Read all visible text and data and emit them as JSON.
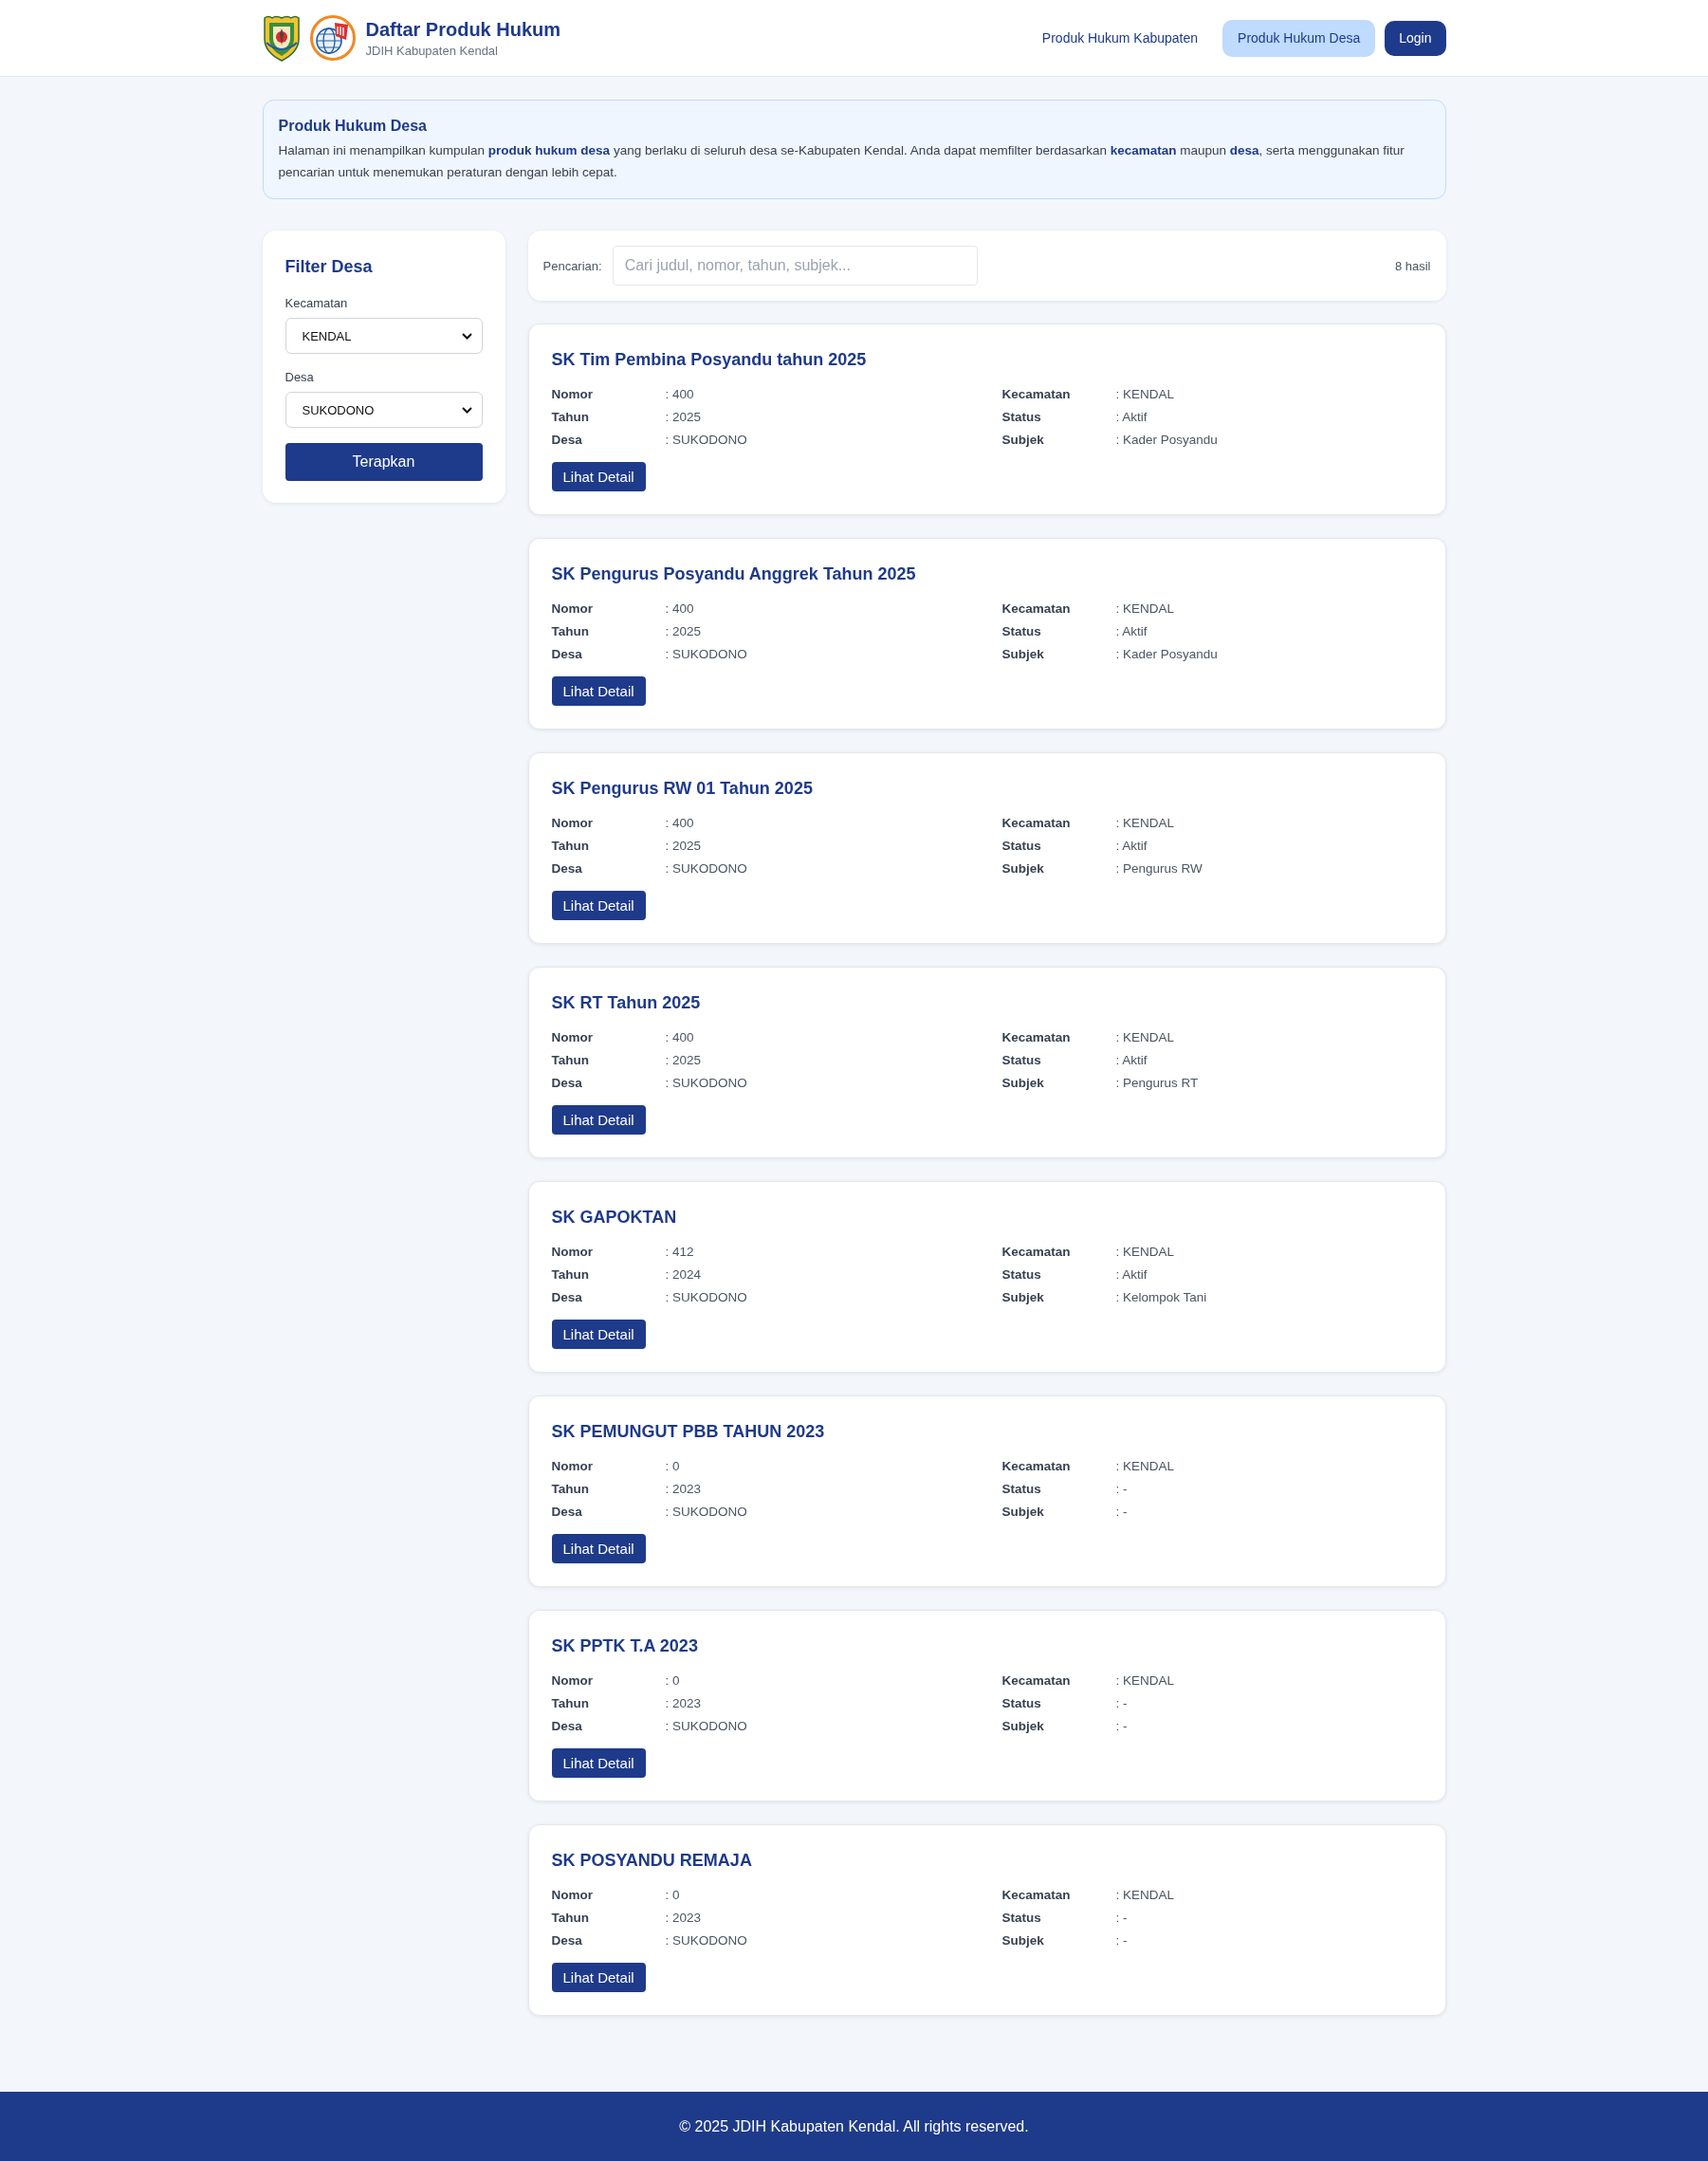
{
  "header": {
    "title": "Daftar Produk Hukum",
    "subtitle": "JDIH Kabupaten Kendal",
    "nav_links": [
      {
        "label": "Produk Hukum Kabupaten",
        "selected": false
      },
      {
        "label": "Produk Hukum Desa",
        "selected": true
      }
    ],
    "login_button": "Login"
  },
  "intro": {
    "title": "Produk Hukum Desa",
    "text": "Halaman ini menampilkan kumpulan **produk hukum desa** yang berlaku di seluruh desa se-Kabupaten Kendal. Anda dapat memfilter berdasarkan **kecamatan** maupun **desa**, serta menggunakan fitur pencarian untuk menemukan peraturan dengan lebih cepat."
  },
  "filter": {
    "title": "Filter Desa",
    "fields": [
      {
        "label": "Kecamatan",
        "value": "KENDAL"
      },
      {
        "label": "Desa",
        "value": "SUKODONO"
      }
    ],
    "button": "Terapkan"
  },
  "search": {
    "label": "Pencarian:",
    "placeholder": "Cari judul, nomor, tahun, subjek...",
    "count": "8 hasil"
  },
  "results": [
    {
      "title": "SK Tim Pembina Posyandu tahun 2025",
      "details": [
        [
          {
            "label": "Nomor",
            "value": ": 400"
          },
          {
            "label": "Tahun",
            "value": ": 2025"
          },
          {
            "label": "Desa",
            "value": ": SUKODONO"
          }
        ],
        [
          {
            "label": "Kecamatan",
            "value": ": KENDAL"
          },
          {
            "label": "Status",
            "value": ": Aktif"
          },
          {
            "label": "Subjek",
            "value": ": Kader Posyandu"
          }
        ]
      ],
      "button": "Lihat Detail"
    },
    {
      "title": "SK Pengurus Posyandu Anggrek Tahun 2025",
      "details": [
        [
          {
            "label": "Nomor",
            "value": ": 400"
          },
          {
            "label": "Tahun",
            "value": ": 2025"
          },
          {
            "label": "Desa",
            "value": ": SUKODONO"
          }
        ],
        [
          {
            "label": "Kecamatan",
            "value": ": KENDAL"
          },
          {
            "label": "Status",
            "value": ": Aktif"
          },
          {
            "label": "Subjek",
            "value": ": Kader Posyandu"
          }
        ]
      ],
      "button": "Lihat Detail"
    },
    {
      "title": "SK Pengurus RW 01 Tahun 2025",
      "details": [
        [
          {
            "label": "Nomor",
            "value": ": 400"
          },
          {
            "label": "Tahun",
            "value": ": 2025"
          },
          {
            "label": "Desa",
            "value": ": SUKODONO"
          }
        ],
        [
          {
            "label": "Kecamatan",
            "value": ": KENDAL"
          },
          {
            "label": "Status",
            "value": ": Aktif"
          },
          {
            "label": "Subjek",
            "value": ": Pengurus RW"
          }
        ]
      ],
      "button": "Lihat Detail"
    },
    {
      "title": "SK RT Tahun 2025",
      "details": [
        [
          {
            "label": "Nomor",
            "value": ": 400"
          },
          {
            "label": "Tahun",
            "value": ": 2025"
          },
          {
            "label": "Desa",
            "value": ": SUKODONO"
          }
        ],
        [
          {
            "label": "Kecamatan",
            "value": ": KENDAL"
          },
          {
            "label": "Status",
            "value": ": Aktif"
          },
          {
            "label": "Subjek",
            "value": ": Pengurus RT"
          }
        ]
      ],
      "button": "Lihat Detail"
    },
    {
      "title": "SK GAPOKTAN",
      "details": [
        [
          {
            "label": "Nomor",
            "value": ": 412"
          },
          {
            "label": "Tahun",
            "value": ": 2024"
          },
          {
            "label": "Desa",
            "value": ": SUKODONO"
          }
        ],
        [
          {
            "label": "Kecamatan",
            "value": ": KENDAL"
          },
          {
            "label": "Status",
            "value": ": Aktif"
          },
          {
            "label": "Subjek",
            "value": ": Kelompok Tani"
          }
        ]
      ],
      "button": "Lihat Detail"
    },
    {
      "title": "SK PEMUNGUT PBB TAHUN 2023",
      "details": [
        [
          {
            "label": "Nomor",
            "value": ": 0"
          },
          {
            "label": "Tahun",
            "value": ": 2023"
          },
          {
            "label": "Desa",
            "value": ": SUKODONO"
          }
        ],
        [
          {
            "label": "Kecamatan",
            "value": ": KENDAL"
          },
          {
            "label": "Status",
            "value": ": -"
          },
          {
            "label": "Subjek",
            "value": ": -"
          }
        ]
      ],
      "button": "Lihat Detail"
    },
    {
      "title": "SK PPTK T.A 2023",
      "details": [
        [
          {
            "label": "Nomor",
            "value": ": 0"
          },
          {
            "label": "Tahun",
            "value": ": 2023"
          },
          {
            "label": "Desa",
            "value": ": SUKODONO"
          }
        ],
        [
          {
            "label": "Kecamatan",
            "value": ": KENDAL"
          },
          {
            "label": "Status",
            "value": ": -"
          },
          {
            "label": "Subjek",
            "value": ": -"
          }
        ]
      ],
      "button": "Lihat Detail"
    },
    {
      "title": "SK POSYANDU REMAJA",
      "details": [
        [
          {
            "label": "Nomor",
            "value": ": 0"
          },
          {
            "label": "Tahun",
            "value": ": 2023"
          },
          {
            "label": "Desa",
            "value": ": SUKODONO"
          }
        ],
        [
          {
            "label": "Kecamatan",
            "value": ": KENDAL"
          },
          {
            "label": "Status",
            "value": ": -"
          },
          {
            "label": "Subjek",
            "value": ": -"
          }
        ]
      ],
      "button": "Lihat Detail"
    }
  ],
  "footer": {
    "text": "© 2025 JDIH Kabupaten Kendal. All rights reserved."
  }
}
